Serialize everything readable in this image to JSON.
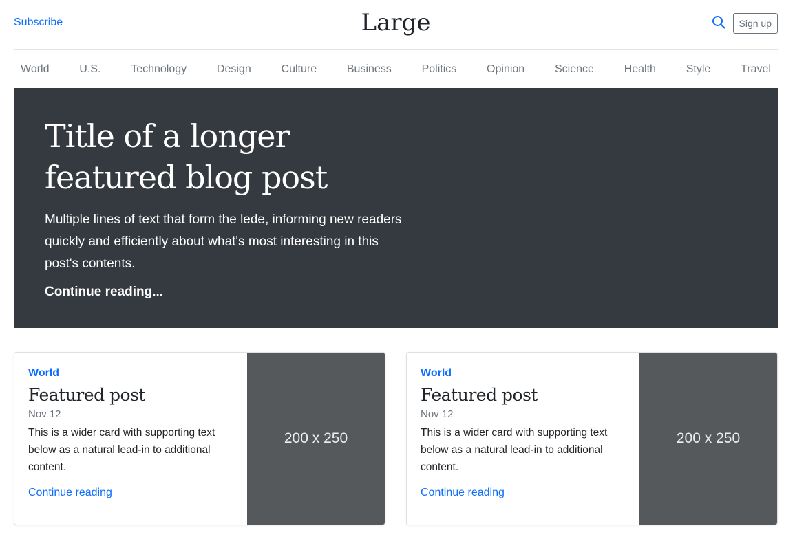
{
  "header": {
    "subscribe_label": "Subscribe",
    "logo_text": "Large",
    "signup_label": "Sign up"
  },
  "nav": {
    "items": [
      "World",
      "U.S.",
      "Technology",
      "Design",
      "Culture",
      "Business",
      "Politics",
      "Opinion",
      "Science",
      "Health",
      "Style",
      "Travel"
    ]
  },
  "hero": {
    "title": "Title of a longer featured blog post",
    "lede": "Multiple lines of text that form the lede, informing new readers quickly and efficiently about what's most interesting in this post's contents.",
    "continue_label": "Continue reading..."
  },
  "cards": [
    {
      "category": "World",
      "title": "Featured post",
      "date": "Nov 12",
      "text": "This is a wider card with supporting text below as a natural lead-in to additional content.",
      "link_label": "Continue reading",
      "thumb_label": "200 x 250"
    },
    {
      "category": "World",
      "title": "Featured post",
      "date": "Nov 12",
      "text": "This is a wider card with supporting text below as a natural lead-in to additional content.",
      "link_label": "Continue reading",
      "thumb_label": "200 x 250"
    }
  ],
  "colors": {
    "accent": "#0d6efd",
    "hero_bg": "#343a40",
    "thumb_bg": "#55595c",
    "muted": "#6c757d"
  },
  "icons": {
    "search": "search-icon"
  }
}
